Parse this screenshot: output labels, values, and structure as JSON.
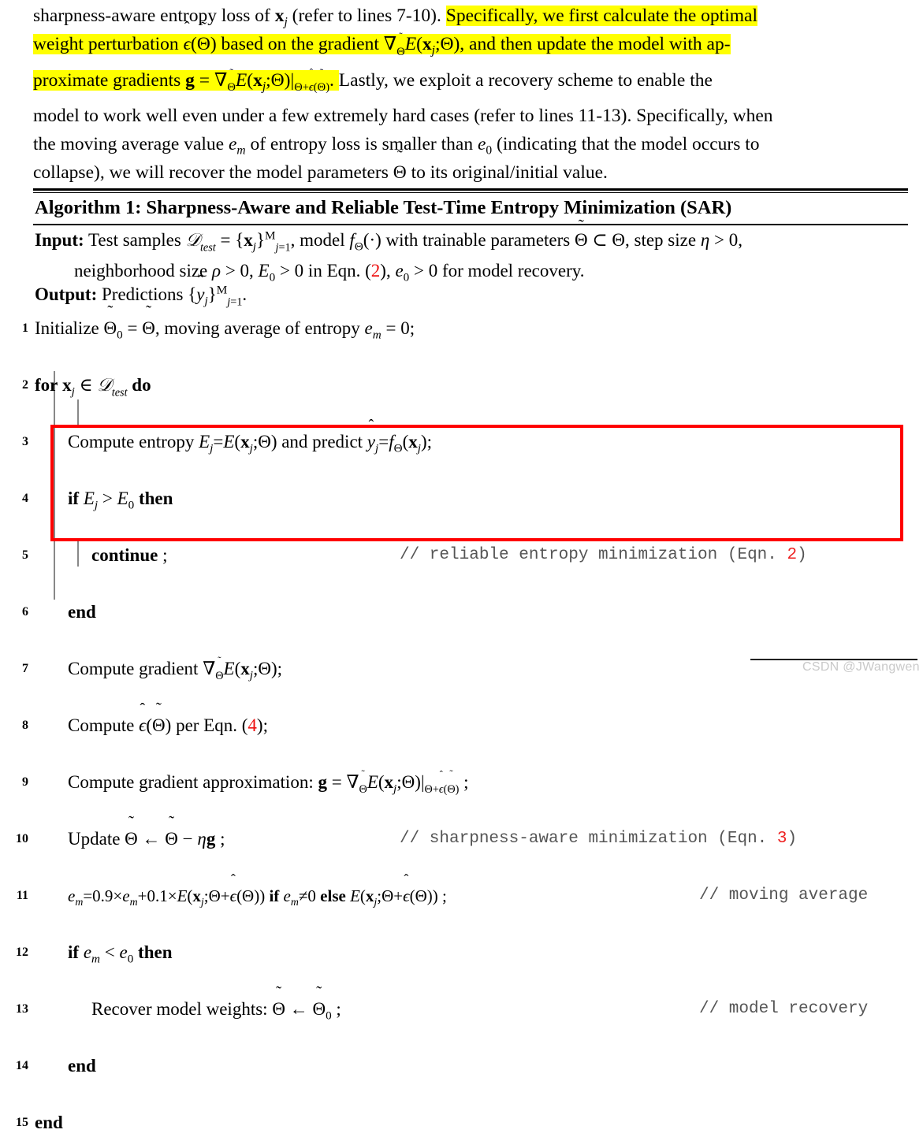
{
  "document": {
    "type": "paper-excerpt",
    "paragraph": {
      "plain_before": "sharpness-aware entropy loss of x_j (refer to lines 7-10). ",
      "highlighted_1": "Specifically, we first calculate the optimal weight perturbation ε̂(Θ̃) based on the gradient ∇_Θ̃E(x_j;Θ), and then update the model with approximate gradients g = ∇_Θ̃E(x_j;Θ)|_{Θ+ε̂(Θ̃)}.",
      "plain_after": "Lastly, we exploit a recovery scheme to enable the model to work well even under a few extremely hard cases (refer to lines 11-13). Specifically, when the moving average value e_m of entropy loss is smaller than e_0 (indicating that the model occurs to collapse), we will recover the model parameters Θ̃ to its original/initial value.",
      "highlight_color": "#ffff00",
      "segments": {
        "s1": "sharpness-aware entropy loss of ",
        "s2": " (refer to lines 7-10). ",
        "s3": "Specifically, we first calculate the optimal",
        "s4": "weight perturbation ",
        "s5": " based on the gradient ",
        "s6": ", and then update the model with ap-",
        "s7": "proximate gradients ",
        "s8": ". ",
        "s9": "Lastly, we exploit a recovery scheme to enable the",
        "s10": "model to work well even under a few extremely hard cases (refer to lines 11-13). Specifically, when",
        "s11": "the moving average value ",
        "s12": " of entropy loss is smaller than ",
        "s13": " (indicating that the model occurs to",
        "s14": "collapse), we will recover the model parameters ",
        "s15": " to its original/initial value."
      }
    },
    "algorithm": {
      "title_prefix": "Algorithm 1:",
      "title_text": "Sharpness-Aware and Reliable Test-Time Entropy Minimization (SAR)",
      "input_label": "Input:",
      "input_line1": "Test samples D_test = {x_j}^M_{j=1}, model f_Θ(·) with trainable parameters Θ̃ ⊂ Θ, step size η > 0,",
      "input_line2": "neighborhood size ρ > 0, E_0 > 0 in Eqn. (2), e_0 > 0 for model recovery.",
      "input_eqn_ref": "2",
      "output_label": "Output:",
      "output_text": "Predictions {ŷ_j}^M_{j=1}.",
      "lines": [
        {
          "num": "1",
          "text": "Initialize Θ̃_0 = Θ̃, moving average of entropy e_m = 0;",
          "comment": ""
        },
        {
          "num": "2",
          "text": "for x_j ∈ D_test do",
          "comment": ""
        },
        {
          "num": "3",
          "text": "Compute entropy E_j=E(x_j;Θ) and predict ŷ_j=f_Θ(x_j);",
          "comment": ""
        },
        {
          "num": "4",
          "text": "if E_j > E_0 then",
          "comment": ""
        },
        {
          "num": "5",
          "text": "continue ;",
          "comment": "// reliable entropy minimization (Eqn. 2)"
        },
        {
          "num": "6",
          "text": "end",
          "comment": ""
        },
        {
          "num": "7",
          "text": "Compute gradient ∇_Θ̃E(x_j;Θ);",
          "comment": ""
        },
        {
          "num": "8",
          "text": "Compute ε̂(Θ̃) per Eqn. (4);",
          "comment": ""
        },
        {
          "num": "9",
          "text": "Compute gradient approximation: g = ∇_Θ̃E(x_j;Θ)|_{Θ+ε̂(Θ̃)} ;",
          "comment": ""
        },
        {
          "num": "10",
          "text": "Update Θ̃ ← Θ̃ − ηg ;",
          "comment": "// sharpness-aware minimization (Eqn. 3)"
        },
        {
          "num": "11",
          "text": "e_m=0.9×e_m+0.1×E(x_j;Θ+ε̂(Θ)) if e_m≠0 else E(x_j;Θ+ε̂(Θ)) ;",
          "comment": "// moving average"
        },
        {
          "num": "12",
          "text": "if e_m < e_0 then",
          "comment": ""
        },
        {
          "num": "13",
          "text": "Recover model weights: Θ̃ ← Θ̃_0 ;",
          "comment": "// model recovery"
        },
        {
          "num": "14",
          "text": "end",
          "comment": ""
        },
        {
          "num": "15",
          "text": "end",
          "comment": ""
        }
      ],
      "comment_texts": {
        "c5_body": "// reliable entropy minimization (Eqn. ",
        "c5_num": "2",
        "c5_end": ")",
        "c10_body": "// sharpness-aware minimization (Eqn. ",
        "c10_num": "3",
        "c10_end": ")",
        "c11": "// moving average",
        "c13": "// model recovery"
      },
      "annotation": {
        "red_box_label": "red-highlight-box-lines-7-10",
        "red_box_color": "#ff0000",
        "covers_lines": "7-10"
      }
    },
    "watermark": {
      "text": "CSDN @JWangwen",
      "color": "#c9c9c9"
    }
  }
}
